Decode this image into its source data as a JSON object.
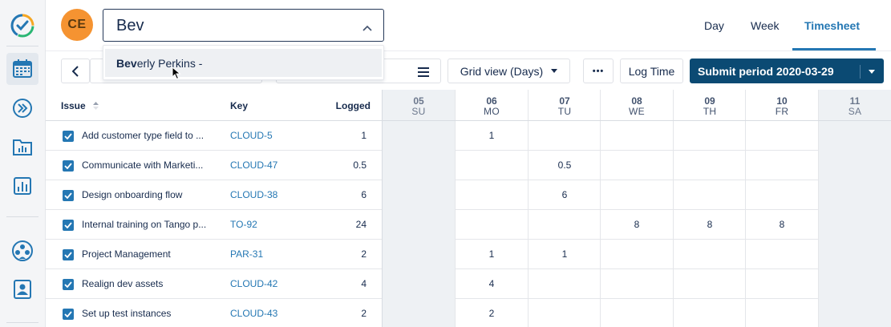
{
  "header": {
    "avatar_initials": "CE",
    "user_search_value": "Bev",
    "tabs": [
      {
        "label": "Day",
        "active": false
      },
      {
        "label": "Week",
        "active": false
      },
      {
        "label": "Timesheet",
        "active": true
      }
    ]
  },
  "dropdown": {
    "option_match": "Bev",
    "option_rest": "erly Perkins -"
  },
  "toolbar": {
    "grid_view_label": "Grid view (Days)",
    "more_label": "•••",
    "log_time_label": "Log Time",
    "submit_label": "Submit period 2020-03-29"
  },
  "table": {
    "columns": {
      "issue": "Issue",
      "key": "Key",
      "logged": "Logged"
    },
    "days": [
      {
        "num": "05",
        "wd": "SU",
        "weekend": true
      },
      {
        "num": "06",
        "wd": "MO",
        "weekend": false
      },
      {
        "num": "07",
        "wd": "TU",
        "weekend": false
      },
      {
        "num": "08",
        "wd": "WE",
        "weekend": false
      },
      {
        "num": "09",
        "wd": "TH",
        "weekend": false
      },
      {
        "num": "10",
        "wd": "FR",
        "weekend": false
      },
      {
        "num": "11",
        "wd": "SA",
        "weekend": true
      }
    ],
    "rows": [
      {
        "issue": "Add customer type field to ...",
        "key": "CLOUD-5",
        "logged": "1",
        "days": [
          "",
          "1",
          "",
          "",
          "",
          "",
          ""
        ]
      },
      {
        "issue": "Communicate with Marketi...",
        "key": "CLOUD-47",
        "logged": "0.5",
        "days": [
          "",
          "",
          "0.5",
          "",
          "",
          "",
          ""
        ]
      },
      {
        "issue": "Design onboarding flow",
        "key": "CLOUD-38",
        "logged": "6",
        "days": [
          "",
          "",
          "6",
          "",
          "",
          "",
          ""
        ]
      },
      {
        "issue": "Internal training on Tango p...",
        "key": "TO-92",
        "logged": "24",
        "days": [
          "",
          "",
          "",
          "8",
          "8",
          "8",
          ""
        ]
      },
      {
        "issue": "Project Management",
        "key": "PAR-31",
        "logged": "2",
        "days": [
          "",
          "1",
          "1",
          "",
          "",
          "",
          ""
        ]
      },
      {
        "issue": "Realign dev assets",
        "key": "CLOUD-42",
        "logged": "4",
        "days": [
          "",
          "4",
          "",
          "",
          "",
          "",
          ""
        ]
      },
      {
        "issue": "Set up test instances",
        "key": "CLOUD-43",
        "logged": "2",
        "days": [
          "",
          "2",
          "",
          "",
          "",
          "",
          ""
        ]
      }
    ]
  },
  "colors": {
    "accent": "#2477b3",
    "submit": "#0b4a73",
    "avatar": "#f59331",
    "weekend": "#eef1f4"
  }
}
